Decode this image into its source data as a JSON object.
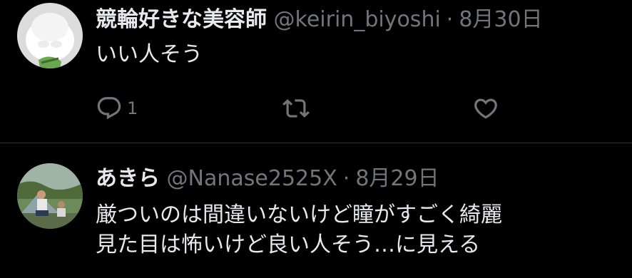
{
  "tweets": [
    {
      "display_name": "競輪好きな美容師",
      "handle": "@keirin_biyoshi",
      "separator": "·",
      "date": "8月30日",
      "text_lines": [
        "いい人そう"
      ],
      "reply_count": "1"
    },
    {
      "display_name": "あきら",
      "handle": "@Nanase2525X",
      "separator": "·",
      "date": "8月29日",
      "text_lines": [
        "厳ついのは間違いないけど瞳がすごく綺麗",
        "見た目は怖いけど良い人そう…に見える"
      ]
    }
  ],
  "colors": {
    "background": "#000000",
    "text_primary": "#e7e9ea",
    "text_secondary": "#71767b",
    "divider": "#2f3336"
  },
  "icons": [
    "reply-icon",
    "retweet-icon",
    "like-icon"
  ]
}
